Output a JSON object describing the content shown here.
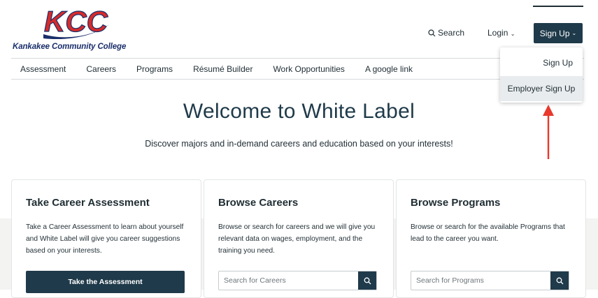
{
  "logo": {
    "initials": "KCC",
    "name": "Kankakee Community College"
  },
  "header": {
    "search_label": "Search",
    "login_label": "Login",
    "signup_label": "Sign Up",
    "login_chevron": "⌄",
    "signup_chevron": "⌄"
  },
  "nav": {
    "items": [
      "Assessment",
      "Careers",
      "Programs",
      "Résumé Builder",
      "Work Opportunities",
      "A google link"
    ]
  },
  "dropdown": {
    "items": [
      "Sign Up",
      "Employer Sign Up"
    ],
    "highlighted": "Employer Sign Up"
  },
  "hero": {
    "title": "Welcome to White Label",
    "subtitle": "Discover majors and in-demand careers and education based on your interests!"
  },
  "cards": [
    {
      "title": "Take Career Assessment",
      "description": "Take a Career Assessment to learn about yourself and White Label will give you career suggestions based on your interests.",
      "button_label": "Take the Assessment"
    },
    {
      "title": "Browse Careers",
      "description": "Browse or search for careers and we will give you relevant data on wages, employment, and the training you need.",
      "search_placeholder": "Search for Careers"
    },
    {
      "title": "Browse Programs",
      "description": "Browse or search for the available Programs that lead to the career you want.",
      "search_placeholder": "Search for Programs"
    }
  ],
  "colors": {
    "brand_dark": "#1f3a4a",
    "logo_red": "#d62b2b",
    "logo_blue": "#1a2e6b",
    "annotation_arrow": "#e8392c",
    "band_bg": "#f3f3f1"
  }
}
